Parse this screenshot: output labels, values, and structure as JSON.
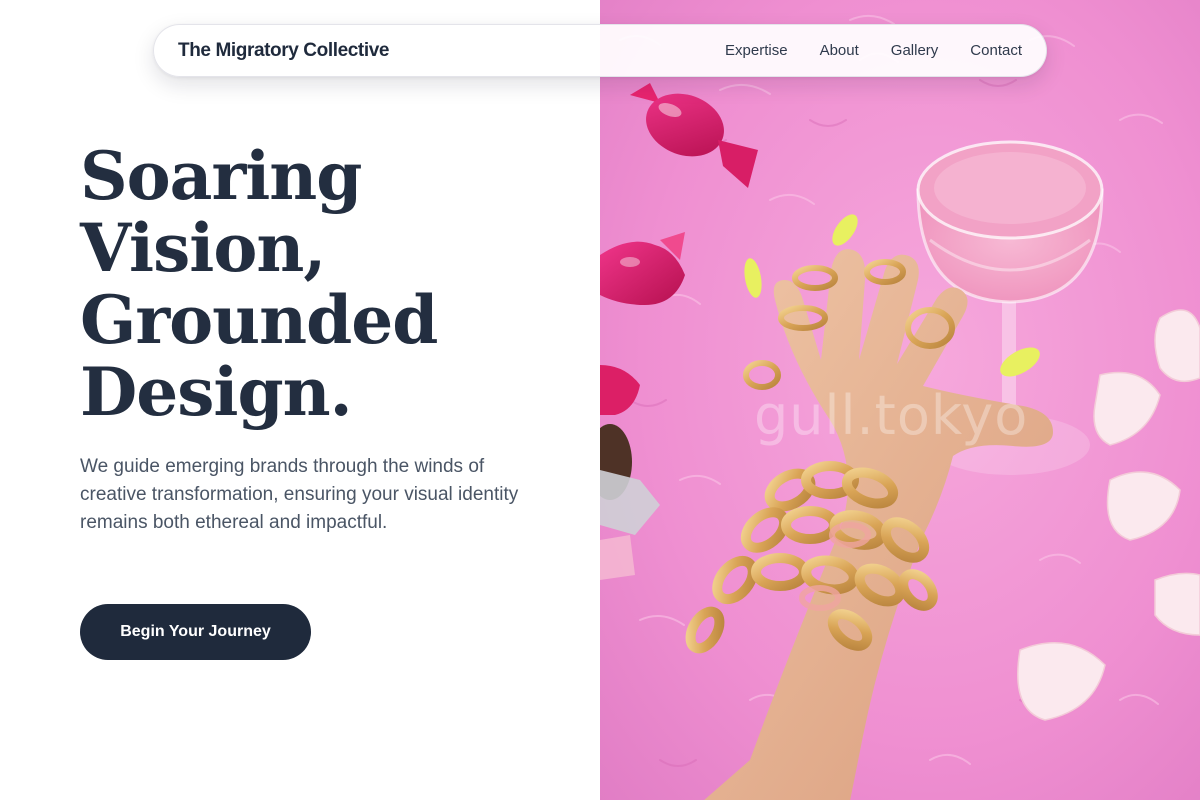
{
  "nav": {
    "brand": "The Migratory Collective",
    "links": [
      "Expertise",
      "About",
      "Gallery",
      "Contact"
    ]
  },
  "hero": {
    "title_lines": [
      "Soaring",
      "Vision,",
      "Grounded",
      "Design."
    ],
    "description": "We guide emerging brands through the winds of creative transformation, ensuring your visual identity remains both ethereal and impactful.",
    "cta_label": "Begin Your Journey"
  },
  "image": {
    "watermark": "gull.tokyo"
  },
  "colors": {
    "navy": "#1f2a3c",
    "text_muted": "#4a5565",
    "fur_pink": "#f08fd0",
    "candy_magenta": "#e0206e",
    "gold": "#d9a85a",
    "nail_yellow": "#e8f060"
  }
}
